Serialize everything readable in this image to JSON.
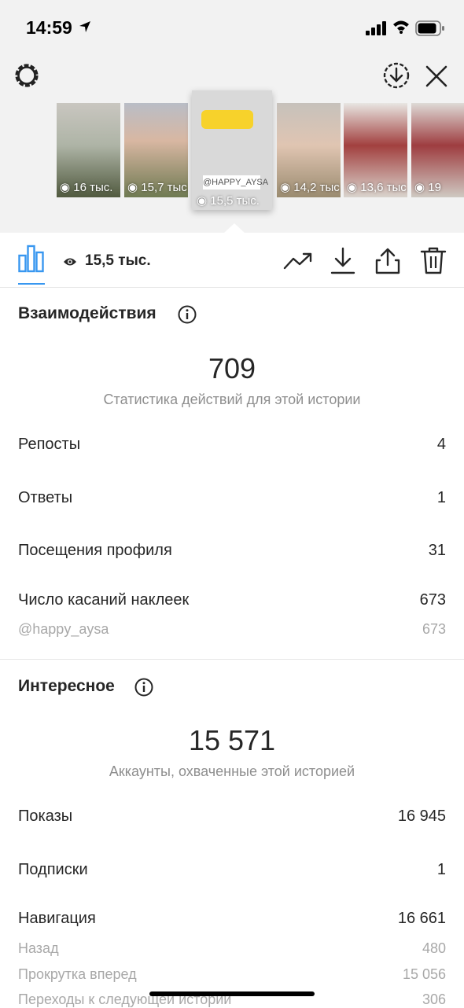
{
  "status_bar": {
    "time": "14:59"
  },
  "stories": [
    {
      "views": "16 тыс."
    },
    {
      "views": "15,7 тыс."
    },
    {
      "views": "15,5 тыс.",
      "selected": true,
      "tag": "@HAPPY_AYSA"
    },
    {
      "views": "14,2 тыс."
    },
    {
      "views": "13,6 тыс."
    },
    {
      "views": "19"
    }
  ],
  "toolbar": {
    "views": "15,5 тыс."
  },
  "interactions": {
    "title": "Взаимодействия",
    "total": "709",
    "subtitle": "Статистика действий для этой истории",
    "rows": [
      {
        "label": "Репосты",
        "value": "4"
      },
      {
        "label": "Ответы",
        "value": "1"
      },
      {
        "label": "Посещения профиля",
        "value": "31"
      },
      {
        "label": "Число касаний наклеек",
        "value": "673"
      }
    ],
    "sub_rows": [
      {
        "label": "@happy_aysa",
        "value": "673"
      }
    ]
  },
  "discovery": {
    "title": "Интересное",
    "total": "15 571",
    "subtitle": "Аккаунты, охваченные этой историей",
    "rows": [
      {
        "label": "Показы",
        "value": "16 945"
      },
      {
        "label": "Подписки",
        "value": "1"
      },
      {
        "label": "Навигация",
        "value": "16 661"
      }
    ],
    "sub_rows": [
      {
        "label": "Назад",
        "value": "480"
      },
      {
        "label": "Прокрутка вперед",
        "value": "15 056"
      },
      {
        "label": "Переходы к следующей истории",
        "value": "306"
      }
    ]
  },
  "colors": {
    "accent": "#3897f0",
    "text": "#262626",
    "secondary": "#8e8e8e",
    "header_bg": "#f2f2f2"
  }
}
